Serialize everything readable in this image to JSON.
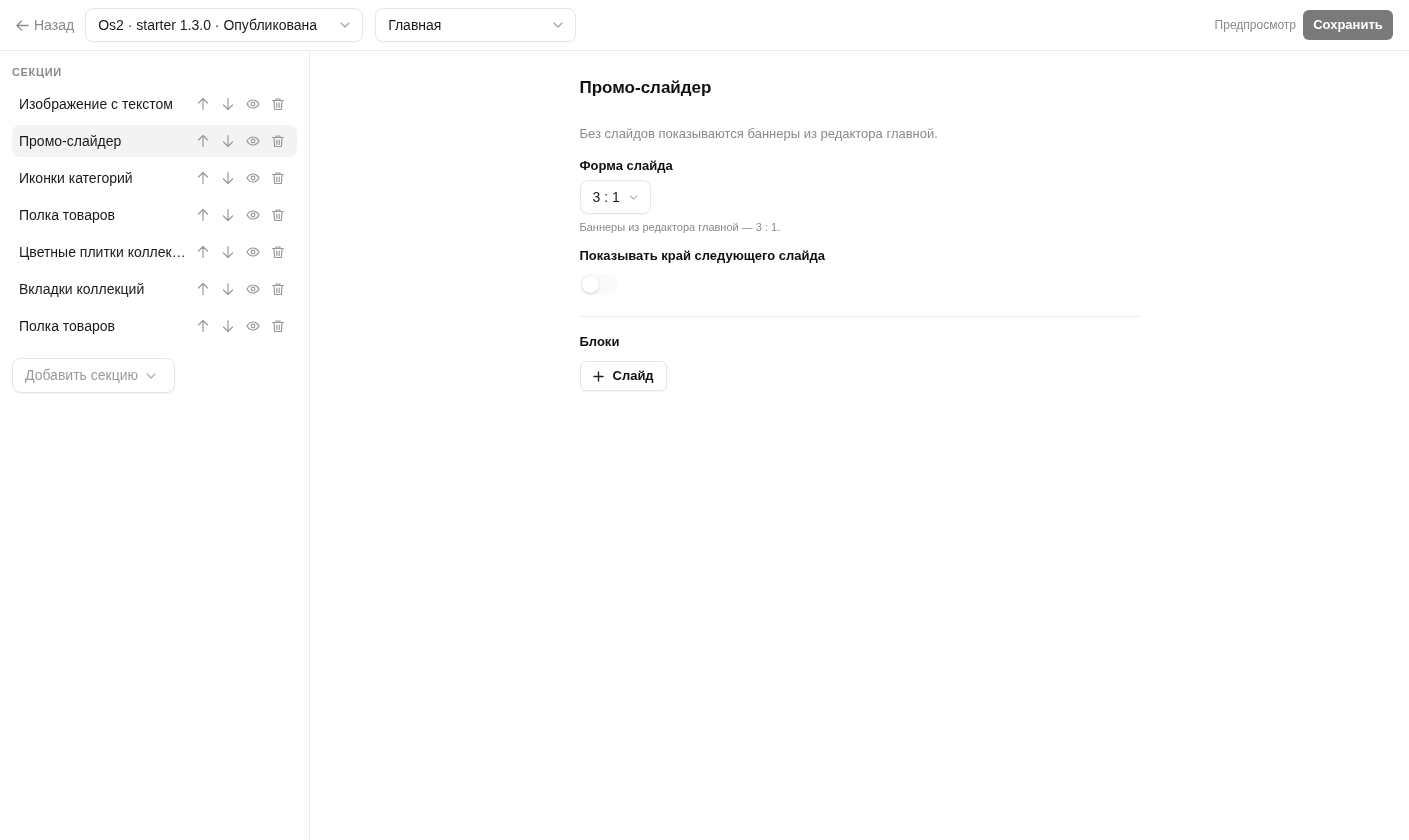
{
  "top_bar": {
    "back_link": "Назад",
    "project_select": {
      "value": "Os2 · starter 1.3.0 · Опубликована"
    },
    "page_select": {
      "value": "Главная"
    },
    "preview_link": "Предпросмотр",
    "save_button": {
      "label": "Сохранить",
      "disabled": true
    }
  },
  "sidebar": {
    "heading": "СЕКЦИИ",
    "sections": [
      {
        "label": "Изображение с текстом",
        "selected": false
      },
      {
        "label": "Промо-слайдер",
        "selected": true
      },
      {
        "label": "Иконки категорий",
        "selected": false
      },
      {
        "label": "Полка товаров",
        "selected": false
      },
      {
        "label": "Цветные плитки коллек…",
        "selected": false
      },
      {
        "label": "Вкладки коллекций",
        "selected": false
      },
      {
        "label": "Полка товаров",
        "selected": false
      }
    ],
    "add_section": {
      "placeholder": "Добавить секцию"
    }
  },
  "editor": {
    "title": "Промо-слайдер",
    "description": "Без слайдов показываются баннеры из редактора главной.",
    "fields": [
      {
        "kind": "select",
        "label": "Форма слайда",
        "value": "3 : 1",
        "hint": "Баннеры из редактора главной — 3 : 1."
      },
      {
        "kind": "toggle",
        "label": "Показывать край следующего слайда",
        "on": false
      }
    ],
    "blocks": {
      "heading": "Блоки",
      "add_button": "Слайд"
    }
  }
}
